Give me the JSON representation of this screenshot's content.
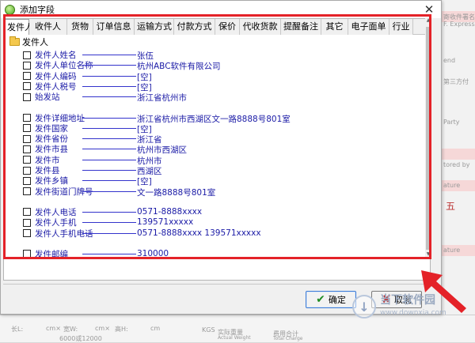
{
  "window": {
    "title": "添加字段",
    "close": "✕"
  },
  "tabs": [
    "发件人",
    "收件人",
    "货物",
    "订单信息",
    "运输方式",
    "付款方式",
    "保价",
    "代收货款",
    "提醒备注",
    "其它",
    "电子面单",
    "行业"
  ],
  "tree": {
    "root": "发件人",
    "groups": [
      [
        {
          "label": "发件人姓名",
          "value": "张伍"
        },
        {
          "label": "发件人单位名称",
          "value": "杭州ABC软件有限公司"
        },
        {
          "label": "发件人编码",
          "value": "[空]"
        },
        {
          "label": "发件人税号",
          "value": "[空]"
        },
        {
          "label": "始发站",
          "value": "浙江省杭州市"
        }
      ],
      [
        {
          "label": "发件详细地址",
          "value": "浙江省杭州市西湖区文一路8888号801室"
        },
        {
          "label": "发件国家",
          "value": "[空]"
        },
        {
          "label": "发件省份",
          "value": "浙江省"
        },
        {
          "label": "发件市县",
          "value": "杭州市西湖区"
        },
        {
          "label": "发件市",
          "value": "杭州市"
        },
        {
          "label": "发件县",
          "value": "西湖区"
        },
        {
          "label": "发件乡镇",
          "value": "[空]"
        },
        {
          "label": "发件街道门牌号",
          "value": "文一路8888号801室"
        }
      ],
      [
        {
          "label": "发件人电话",
          "value": "0571-8888xxxx"
        },
        {
          "label": "发件人手机",
          "value": "139571xxxxx"
        },
        {
          "label": "发件人手机电话",
          "value": "0571-8888xxxx 139571xxxxx"
        }
      ],
      [
        {
          "label": "发件邮编",
          "value": "310000"
        }
      ]
    ]
  },
  "buttons": {
    "ok": "确定",
    "cancel": "取消"
  },
  "watermark": {
    "name": "当下软件园",
    "url": "www.downxia.com"
  },
  "background": {
    "right_labels": [
      "寄收件署名",
      "F. Express",
      "end",
      "第三方付",
      "Party",
      "tored by",
      "ature",
      "五",
      "ature"
    ],
    "bottom_labels": [
      "长L:",
      "cm×",
      "宽W:",
      "cm×",
      "高H:",
      "cm",
      "KGS",
      "实际重量",
      "Actual Weight",
      "费用合计",
      "Total Charge",
      "6000或12000"
    ]
  },
  "colors": {
    "highlight_border": "#e42228",
    "field_text": "#1a1aa6",
    "arrow": "#e42228"
  }
}
